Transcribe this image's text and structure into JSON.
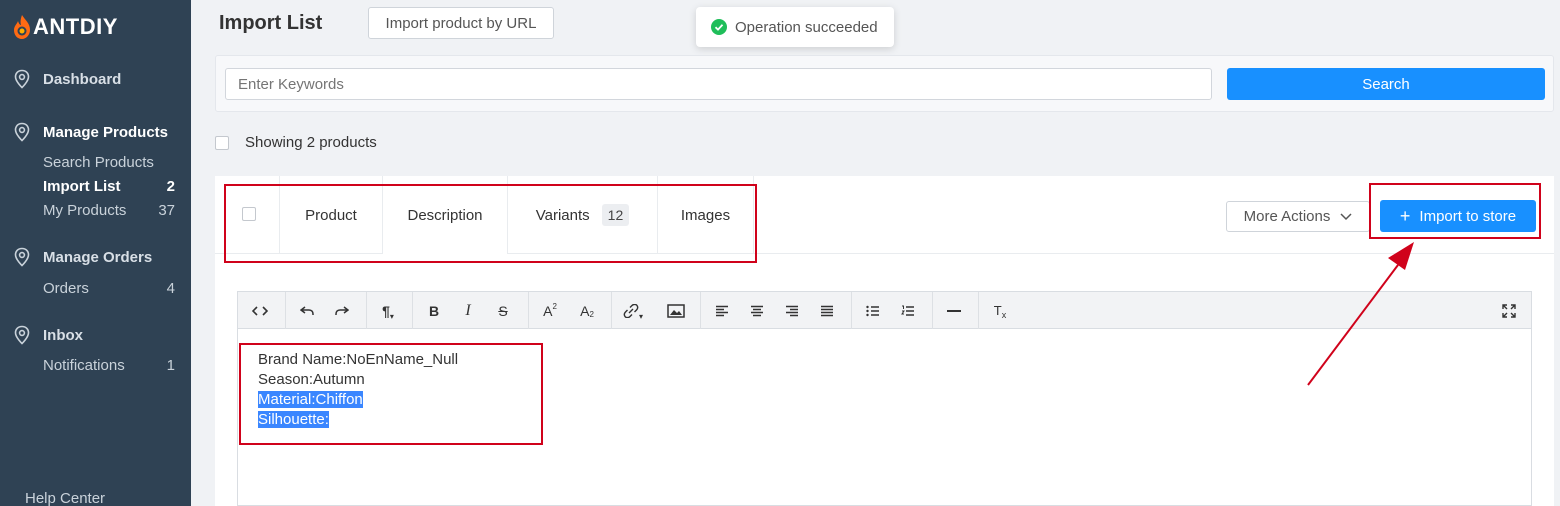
{
  "brand": {
    "name": "ANTDIY"
  },
  "sidebar": {
    "dashboard": "Dashboard",
    "manage_products": "Manage Products",
    "search_products": "Search Products",
    "import_list": {
      "label": "Import List",
      "count": "2"
    },
    "my_products": {
      "label": "My Products",
      "count": "37"
    },
    "manage_orders": "Manage Orders",
    "orders": {
      "label": "Orders",
      "count": "4"
    },
    "inbox": "Inbox",
    "notifications": {
      "label": "Notifications",
      "count": "1"
    },
    "help_center": "Help Center"
  },
  "header": {
    "title": "Import List",
    "import_by_url": "Import product by URL"
  },
  "toast": {
    "message": "Operation succeeded",
    "color": "#1fbe5a"
  },
  "search": {
    "placeholder": "Enter Keywords",
    "button": "Search"
  },
  "list": {
    "showing": "Showing 2 products"
  },
  "product_tabs": {
    "product": "Product",
    "description": "Description",
    "variants": "Variants",
    "variants_count": "12",
    "images": "Images"
  },
  "actions": {
    "more": "More Actions",
    "import": "Import to store"
  },
  "editor": {
    "toolbar": [
      "code-view",
      "undo",
      "redo",
      "paragraph",
      "bold",
      "italic",
      "strikethrough",
      "superscript",
      "subscript",
      "link",
      "image",
      "align-left",
      "align-center",
      "align-right",
      "justify",
      "bullet-list",
      "numbered-list",
      "horizontal-rule",
      "clear-format",
      "fullscreen"
    ],
    "lines": [
      {
        "text": "Brand Name:NoEnName_Null",
        "selected": false
      },
      {
        "text": "Season:Autumn",
        "selected": false
      },
      {
        "text": "Material:Chiffon",
        "selected": true
      },
      {
        "text": "Silhouette:",
        "selected": true
      }
    ]
  },
  "colors": {
    "primary": "#1890ff",
    "sidebar": "#2f4254",
    "annotation": "#d0021b",
    "selection": "#3a86ff"
  }
}
